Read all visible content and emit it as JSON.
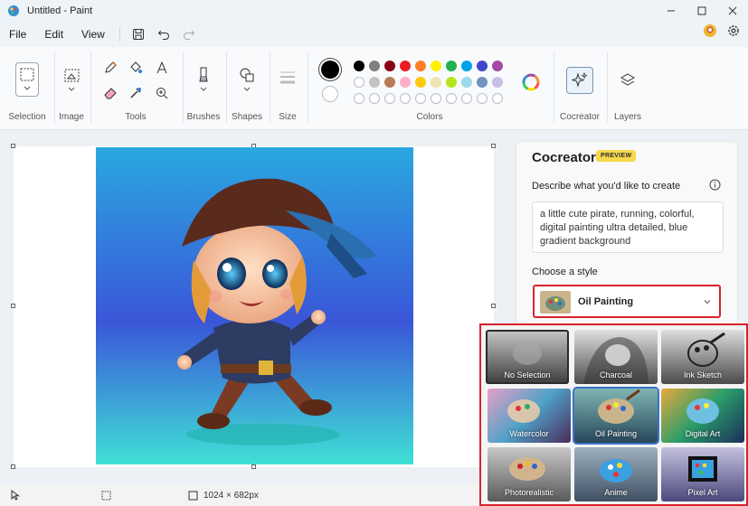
{
  "window": {
    "title": "Untitled - Paint"
  },
  "menu": {
    "file": "File",
    "edit": "Edit",
    "view": "View"
  },
  "ribbon": {
    "groups": {
      "selection": "Selection",
      "image": "Image",
      "tools": "Tools",
      "brushes": "Brushes",
      "shapes": "Shapes",
      "size": "Size",
      "colors": "Colors",
      "cocreator": "Cocreator",
      "layers": "Layers"
    },
    "palette_row1": [
      "#000000",
      "#7f7f7f",
      "#880015",
      "#ed1c24",
      "#ff7f27",
      "#fff200",
      "#22b14c",
      "#00a2e8",
      "#3f48cc",
      "#a349a4"
    ],
    "palette_row2": [
      "#ffffff",
      "#c3c3c3",
      "#b97a57",
      "#ffaec9",
      "#ffc90e",
      "#efe4b0",
      "#b5e61d",
      "#99d9ea",
      "#7092be",
      "#c8bfe7"
    ]
  },
  "cocreator": {
    "title": "Cocreator",
    "badge": "PREVIEW",
    "describe_label": "Describe what you'd like to create",
    "prompt_text": "a little cute pirate, running, colorful, digital painting ultra detailed, blue gradient background",
    "style_label": "Choose a style",
    "selected_style": "Oil Painting",
    "styles": [
      "No Selection",
      "Charcoal",
      "Ink Sketch",
      "Watercolor",
      "Oil Painting",
      "Digital Art",
      "Photorealistic",
      "Anime",
      "Pixel Art"
    ]
  },
  "status": {
    "canvas_size": "1024 × 682px"
  }
}
